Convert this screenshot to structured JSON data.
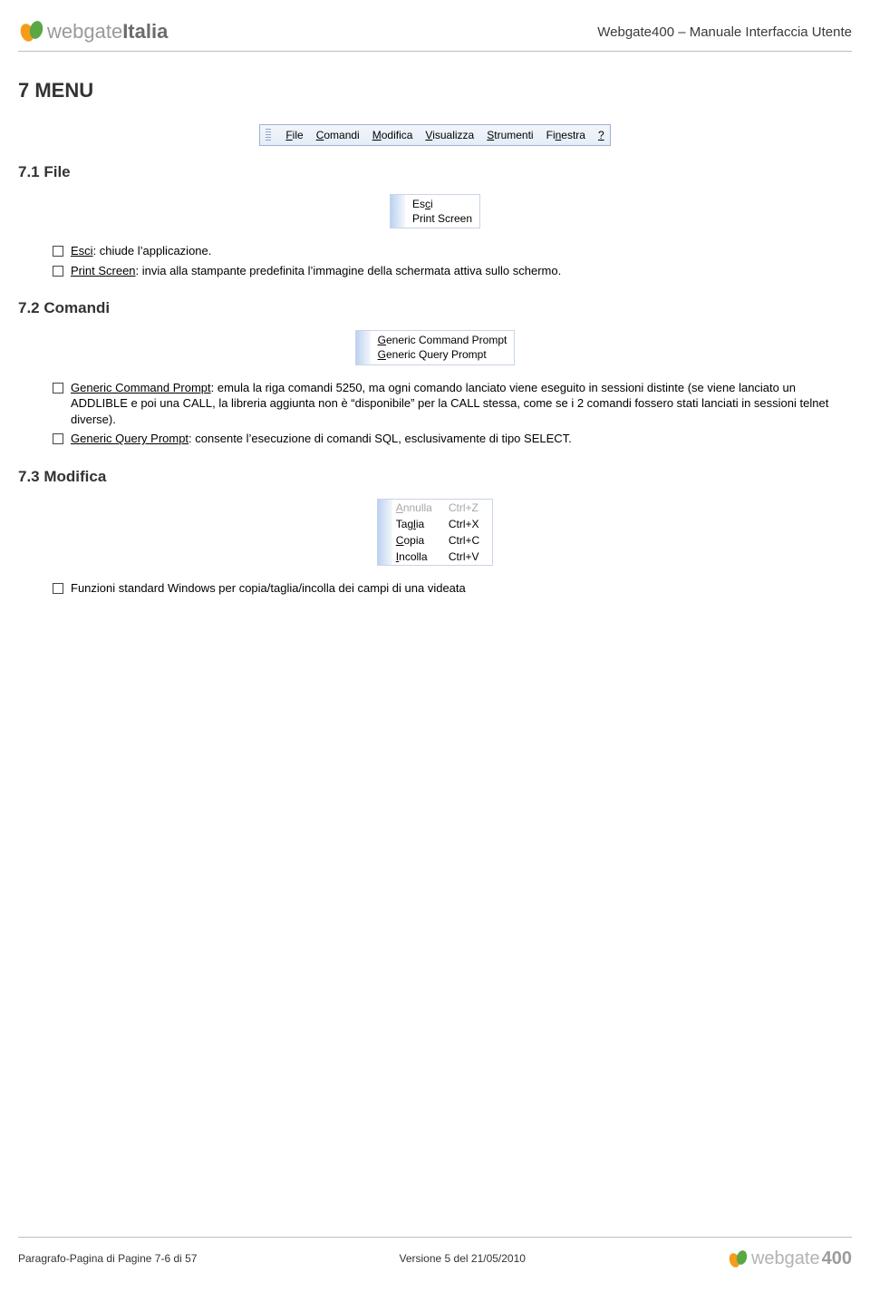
{
  "header": {
    "brand_logo_alt": "webgate-logo",
    "brand_text_plain": "webgate",
    "brand_text_bold": "Italia",
    "doc_title": "Webgate400 – Manuale Interfaccia Utente"
  },
  "h1": "7  MENU",
  "menubar": {
    "items": [
      "File",
      "Comandi",
      "Modifica",
      "Visualizza",
      "Strumenti",
      "Finestra",
      "?"
    ]
  },
  "sec_file": {
    "heading": "7.1  File",
    "submenu": [
      "Esci",
      "Print Screen"
    ],
    "bullets": [
      {
        "term": "Esci",
        "rest": ": chiude l’applicazione."
      },
      {
        "term": "Print Screen",
        "rest": ": invia alla stampante predefinita l’immagine della schermata attiva sullo schermo."
      }
    ]
  },
  "sec_comandi": {
    "heading": "7.2  Comandi",
    "submenu": [
      "Generic Command Prompt",
      "Generic Query Prompt"
    ],
    "bullets": [
      {
        "term": "Generic Command Prompt",
        "rest": ": emula la riga comandi 5250, ma ogni comando lanciato viene eseguito in sessioni distinte (se viene lanciato un ADDLIBLE e poi una CALL, la libreria aggiunta non è “disponibile” per la CALL stessa, come se i 2 comandi fossero stati lanciati in sessioni telnet diverse)."
      },
      {
        "term": "Generic Query Prompt",
        "rest": ":  consente l’esecuzione di comandi SQL, esclusivamente di tipo SELECT."
      }
    ]
  },
  "sec_modifica": {
    "heading": "7.3  Modifica",
    "submenu_table": [
      {
        "label": "Annulla",
        "shortcut": "Ctrl+Z",
        "disabled": true
      },
      {
        "label": "Taglia",
        "shortcut": "Ctrl+X",
        "disabled": false
      },
      {
        "label": "Copia",
        "shortcut": "Ctrl+C",
        "disabled": false
      },
      {
        "label": "Incolla",
        "shortcut": "Ctrl+V",
        "disabled": false
      }
    ],
    "bullets": [
      {
        "term": "",
        "rest": "Funzioni standard Windows per copia/taglia/incolla dei campi di una videata"
      }
    ]
  },
  "footer": {
    "left": "Paragrafo-Pagina di Pagine 7-6 di 57",
    "center": "Versione 5 del 21/05/2010",
    "brand_text_plain": "webgate",
    "brand_text_bold": "400"
  }
}
